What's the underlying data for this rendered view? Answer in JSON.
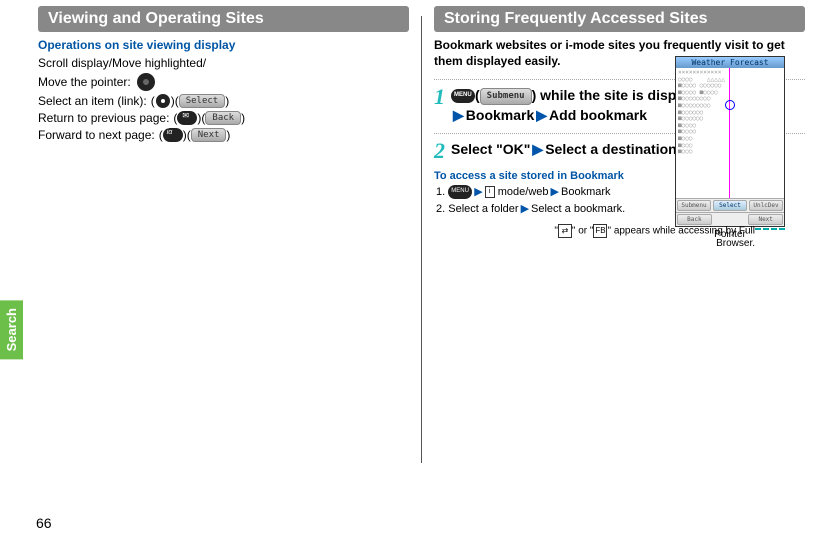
{
  "sidetab": "Search",
  "pagenum": "66",
  "left": {
    "header": "Viewing and Operating Sites",
    "subhead": "Operations on site viewing display",
    "scroll": "Scroll display/Move highlighted/",
    "movepointer": "Move the pointer:",
    "selectitem_pre": "Select an item (link): ",
    "selectitem_pill": "Select",
    "return_pre": "Return to previous page: ",
    "return_pill": "Back",
    "forward_pre": "Forward to next page: ",
    "forward_pill": "Next",
    "phone": {
      "title": "Weather Forecast",
      "sk1": "Submenu",
      "sk2": "Select",
      "sk3": "UnlcDev",
      "sk4": "Back",
      "sk5": "Next"
    },
    "caption_pre": "\"",
    "caption_mid": "\" or \"",
    "caption_post": "\" appears while accessing by Full Browser.",
    "pointer_label": "Pointer"
  },
  "right": {
    "header": "Storing Frequently Accessed Sites",
    "intro": "Bookmark websites or i-mode sites you frequently visit to get them displayed easily.",
    "step1": {
      "pill": "Submenu",
      "tail": " while the site is displayed",
      "line2a": "Bookmark",
      "line2b": "Add bookmark"
    },
    "step2": {
      "a": "Select \"OK\"",
      "b": "Select a destination folder."
    },
    "access_head": "To access a site stored in Bookmark",
    "access1_b": "mode/web",
    "access1_c": "Bookmark",
    "access2_a": "Select a folder",
    "access2_b": "Select a bookmark."
  }
}
